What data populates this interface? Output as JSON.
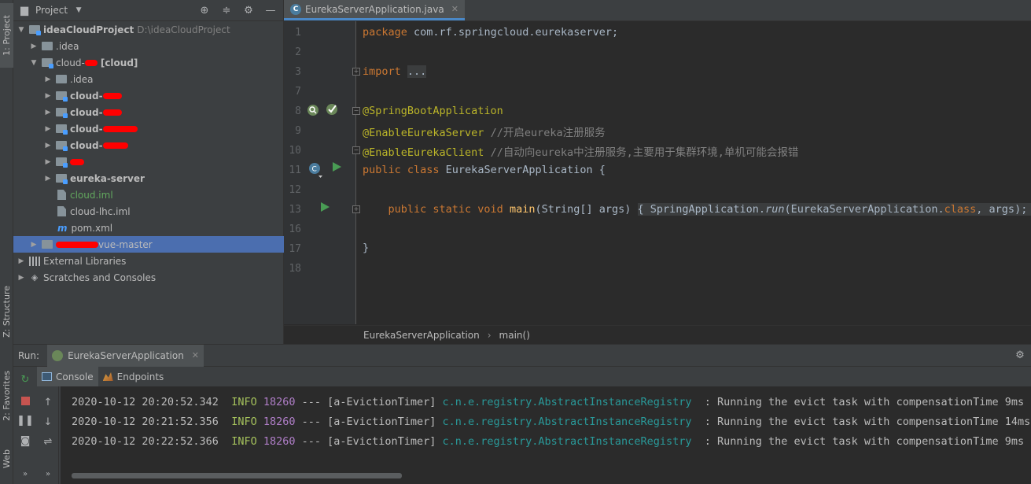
{
  "left_strip": {
    "project_tab": "1: Project",
    "structure_tab": "Z: Structure",
    "favorites_tab": "2: Favorites",
    "web_tab": "Web"
  },
  "project_panel": {
    "title": "Project",
    "tree": [
      {
        "label": "ideaCloudProject",
        "path": "D:\\ideaCloudProject"
      },
      {
        "label": ".idea"
      },
      {
        "label": "cloud-",
        "suffix": "[cloud]"
      },
      {
        "label": ".idea"
      },
      {
        "label": "cloud-"
      },
      {
        "label": "cloud-"
      },
      {
        "label": "cloud-"
      },
      {
        "label": "cloud-"
      },
      {
        "label": ""
      },
      {
        "label": "eureka-server"
      },
      {
        "label": "cloud.iml"
      },
      {
        "label": "cloud-lhc.iml"
      },
      {
        "label": "pom.xml"
      },
      {
        "label": "vue-master"
      },
      {
        "label": "External Libraries"
      },
      {
        "label": "Scratches and Consoles"
      }
    ]
  },
  "editor": {
    "tab_label": "EurekaServerApplication.java",
    "line_numbers": [
      "1",
      "2",
      "3",
      "7",
      "8",
      "9",
      "10",
      "11",
      "12",
      "13",
      "16",
      "17",
      "18"
    ],
    "code": {
      "l1_kw": "package",
      "l1_rest": " com.rf.springcloud.eurekaserver;",
      "l3_kw": "import",
      "l3_fold": "...",
      "l8": "@SpringBootApplication",
      "l9_ann": "@EnableEurekaServer",
      "l9_cmt": " //开启eureka注册服务",
      "l10_ann": "@EnableEurekaClient",
      "l10_cmt": " //自动向eureka中注册服务,主要用于集群环境,单机可能会报错",
      "l11_kw": "public class",
      "l11_rest": " EurekaServerApplication {",
      "l13_kw1": "    public static void",
      "l13_fn": " main",
      "l13_sig": "(String[] args) ",
      "l13_body_pre": "{ SpringApplication.",
      "l13_body_it": "run",
      "l13_body_mid": "(EurekaServerApplication.",
      "l13_body_kw": "class",
      "l13_body_post": ", args); }",
      "l17": "}"
    },
    "breadcrumb": [
      "EurekaServerApplication",
      "main()"
    ]
  },
  "run_panel": {
    "label": "Run:",
    "tab_label": "EurekaServerApplication",
    "sub_tabs": [
      "Console",
      "Endpoints"
    ],
    "logs": [
      {
        "time": "2020-10-12 20:20:52.342",
        "level": "INFO",
        "pid": "18260",
        "sep": "---",
        "thread": "[a-EvictionTimer]",
        "logger": "c.n.e.registry.AbstractInstanceRegistry",
        "msg": ": Running the evict task with compensationTime 9ms"
      },
      {
        "time": "2020-10-12 20:21:52.356",
        "level": "INFO",
        "pid": "18260",
        "sep": "---",
        "thread": "[a-EvictionTimer]",
        "logger": "c.n.e.registry.AbstractInstanceRegistry",
        "msg": ": Running the evict task with compensationTime 14ms"
      },
      {
        "time": "2020-10-12 20:22:52.366",
        "level": "INFO",
        "pid": "18260",
        "sep": "---",
        "thread": "[a-EvictionTimer]",
        "logger": "c.n.e.registry.AbstractInstanceRegistry",
        "msg": ": Running the evict task with compensationTime 9ms"
      }
    ]
  },
  "colors": {
    "background": "#2b2b2b",
    "panel": "#3c3f41",
    "selection": "#4b6eaf",
    "keyword": "#cc7832",
    "annotation": "#bbb529",
    "comment": "#808080",
    "redaction": "#ff0000"
  }
}
